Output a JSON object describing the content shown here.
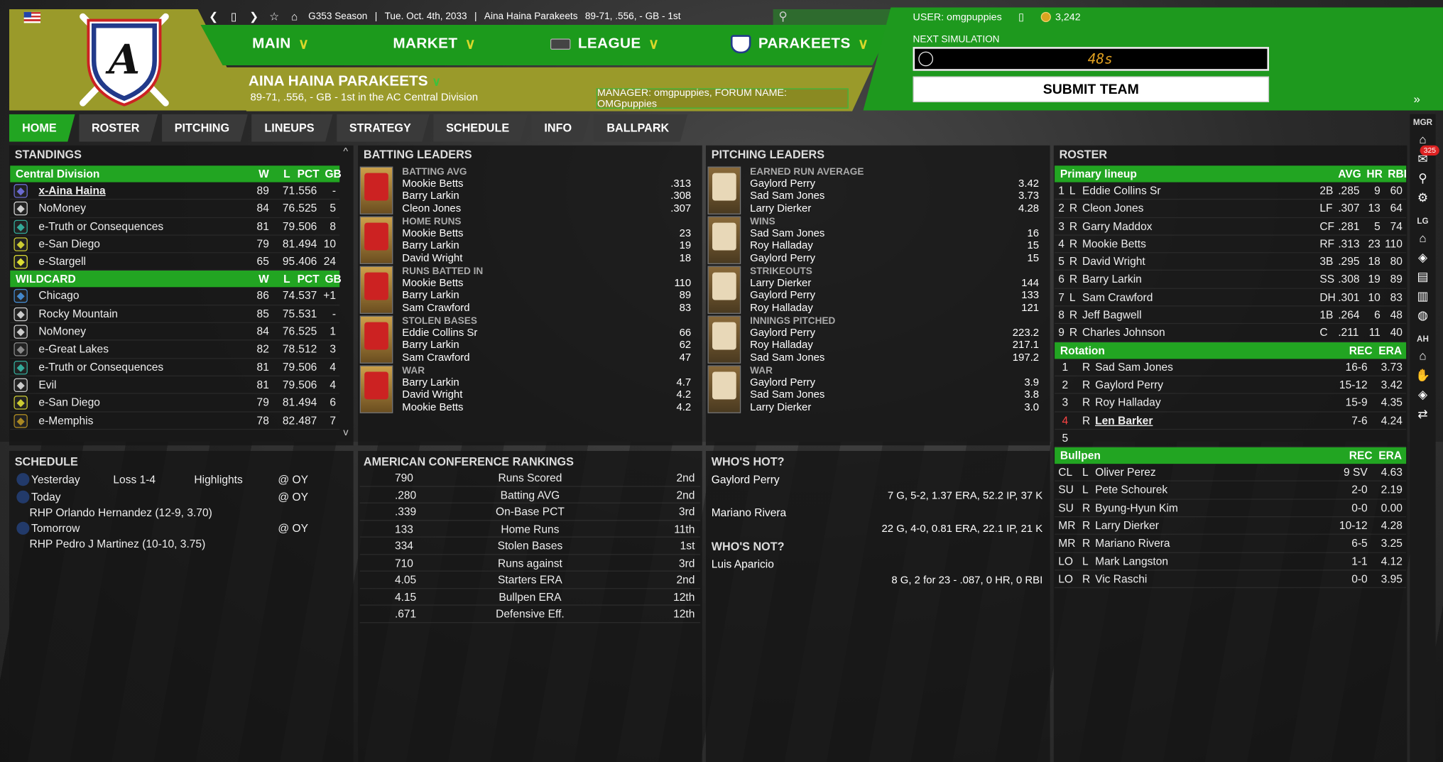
{
  "header": {
    "season": "G353 Season",
    "date": "Tue. Oct. 4th, 2033",
    "team_line": "Aina Haina Parakeets",
    "team_record_short": "89-71, .556, - GB - 1st",
    "nav": [
      {
        "label": "MAIN"
      },
      {
        "label": "MARKET"
      },
      {
        "label": "LEAGUE"
      },
      {
        "label": "PARAKEETS"
      }
    ],
    "team_name": "AINA HAINA PARAKEETS",
    "team_record": "89-71, .556, - GB - 1st in the AC Central Division",
    "manager": "MANAGER:  omgpuppies, FORUM NAME: OMGpuppies",
    "user": "USER: omgpuppies",
    "coins": "3,242",
    "next_sim_label": "NEXT SIMULATION",
    "timer": "48s",
    "submit_label": "SUBMIT TEAM",
    "expand_glyph": "»"
  },
  "tabs": [
    {
      "label": "HOME",
      "active": true
    },
    {
      "label": "ROSTER"
    },
    {
      "label": "PITCHING"
    },
    {
      "label": "LINEUPS"
    },
    {
      "label": "STRATEGY"
    },
    {
      "label": "SCHEDULE"
    },
    {
      "label": "INFO"
    },
    {
      "label": "BALLPARK"
    }
  ],
  "sidebar": {
    "mgr": "MGR",
    "lg": "LG",
    "ah": "AH",
    "badge": "325"
  },
  "standings": {
    "title": "STANDINGS",
    "scroll_up": "^",
    "scroll_down": "v",
    "central_header": {
      "name": "Central Division",
      "w": "W",
      "l": "L",
      "pct": "PCT",
      "gb": "GB"
    },
    "central": [
      {
        "team": "x-Aina Haina",
        "w": "89",
        "l": "71",
        "pct": ".556",
        "gb": "-",
        "icon": "parakeet-logo",
        "color": "#6a6ad0"
      },
      {
        "team": "NoMoney",
        "w": "84",
        "l": "76",
        "pct": ".525",
        "gb": "5",
        "icon": "diamond-logo",
        "color": "#ccc"
      },
      {
        "team": "e-Truth or Consequences",
        "w": "81",
        "l": "79",
        "pct": ".506",
        "gb": "8",
        "icon": "t-logo",
        "color": "#3a9"
      },
      {
        "team": "e-San Diego",
        "w": "79",
        "l": "81",
        "pct": ".494",
        "gb": "10",
        "icon": "m-logo",
        "color": "#cc3"
      },
      {
        "team": "e-Stargell",
        "w": "65",
        "l": "95",
        "pct": ".406",
        "gb": "24",
        "icon": "star-logo",
        "color": "#dd3"
      }
    ],
    "wildcard_header": {
      "name": "WILDCARD",
      "w": "W",
      "l": "L",
      "pct": "PCT",
      "gb": "GB"
    },
    "wildcard": [
      {
        "team": "Chicago",
        "w": "86",
        "l": "74",
        "pct": ".537",
        "gb": "+1",
        "icon": "globe-logo",
        "color": "#48c"
      },
      {
        "team": "Rocky Mountain",
        "w": "85",
        "l": "75",
        "pct": ".531",
        "gb": "-",
        "icon": "diamond-logo",
        "color": "#ccc"
      },
      {
        "team": "NoMoney",
        "w": "84",
        "l": "76",
        "pct": ".525",
        "gb": "1",
        "icon": "diamond-logo",
        "color": "#ccc"
      },
      {
        "team": "e-Great Lakes",
        "w": "82",
        "l": "78",
        "pct": ".512",
        "gb": "3",
        "icon": "script-logo",
        "color": "#888"
      },
      {
        "team": "e-Truth or Consequences",
        "w": "81",
        "l": "79",
        "pct": ".506",
        "gb": "4",
        "icon": "t-logo",
        "color": "#3a9"
      },
      {
        "team": "Evil",
        "w": "81",
        "l": "79",
        "pct": ".506",
        "gb": "4",
        "icon": "ny-logo",
        "color": "#ccc"
      },
      {
        "team": "e-San Diego",
        "w": "79",
        "l": "81",
        "pct": ".494",
        "gb": "6",
        "icon": "m-logo",
        "color": "#cc3"
      },
      {
        "team": "e-Memphis",
        "w": "78",
        "l": "82",
        "pct": ".487",
        "gb": "7",
        "icon": "bear-logo",
        "color": "#a82"
      }
    ]
  },
  "schedule": {
    "title": "SCHEDULE",
    "yesterday": {
      "label": "Yesterday",
      "result": "Loss 1-4",
      "highlights": "Highlights",
      "opp": "@ OY"
    },
    "today": {
      "label": "Today",
      "opp": "@ OY",
      "pitcher": "RHP Orlando Hernandez (12-9, 3.70)"
    },
    "tomorrow": {
      "label": "Tomorrow",
      "opp": "@ OY",
      "pitcher": "RHP Pedro J Martinez (10-10, 3.75)"
    }
  },
  "batting_leaders": {
    "title": "BATTING LEADERS",
    "groups": [
      {
        "stat": "BATTING AVG",
        "rows": [
          [
            "Mookie Betts",
            ".313"
          ],
          [
            "Barry Larkin",
            ".308"
          ],
          [
            "Cleon Jones",
            ".307"
          ]
        ]
      },
      {
        "stat": "HOME RUNS",
        "rows": [
          [
            "Mookie Betts",
            "23"
          ],
          [
            "Barry Larkin",
            "19"
          ],
          [
            "David Wright",
            "18"
          ]
        ]
      },
      {
        "stat": "RUNS BATTED IN",
        "rows": [
          [
            "Mookie Betts",
            "110"
          ],
          [
            "Barry Larkin",
            "89"
          ],
          [
            "Sam Crawford",
            "83"
          ]
        ]
      },
      {
        "stat": "STOLEN BASES",
        "rows": [
          [
            "Eddie Collins Sr",
            "66"
          ],
          [
            "Barry Larkin",
            "62"
          ],
          [
            "Sam Crawford",
            "47"
          ]
        ]
      },
      {
        "stat": "WAR",
        "rows": [
          [
            "Barry Larkin",
            "4.7"
          ],
          [
            "David Wright",
            "4.2"
          ],
          [
            "Mookie Betts",
            "4.2"
          ]
        ]
      }
    ]
  },
  "pitching_leaders": {
    "title": "PITCHING LEADERS",
    "groups": [
      {
        "stat": "EARNED RUN AVERAGE",
        "rows": [
          [
            "Gaylord Perry",
            "3.42"
          ],
          [
            "Sad Sam Jones",
            "3.73"
          ],
          [
            "Larry Dierker",
            "4.28"
          ]
        ]
      },
      {
        "stat": "WINS",
        "rows": [
          [
            "Sad Sam Jones",
            "16"
          ],
          [
            "Roy Halladay",
            "15"
          ],
          [
            "Gaylord Perry",
            "15"
          ]
        ]
      },
      {
        "stat": "STRIKEOUTS",
        "rows": [
          [
            "Larry Dierker",
            "144"
          ],
          [
            "Gaylord Perry",
            "133"
          ],
          [
            "Roy Halladay",
            "121"
          ]
        ]
      },
      {
        "stat": "INNINGS PITCHED",
        "rows": [
          [
            "Gaylord Perry",
            "223.2"
          ],
          [
            "Roy Halladay",
            "217.1"
          ],
          [
            "Sad Sam Jones",
            "197.2"
          ]
        ]
      },
      {
        "stat": "WAR",
        "rows": [
          [
            "Gaylord Perry",
            "3.9"
          ],
          [
            "Sad Sam Jones",
            "3.8"
          ],
          [
            "Larry Dierker",
            "3.0"
          ]
        ]
      }
    ]
  },
  "rankings": {
    "title": "AMERICAN CONFERENCE RANKINGS",
    "rows": [
      {
        "value": "790",
        "label": "Runs Scored",
        "rank": "2nd"
      },
      {
        "value": ".280",
        "label": "Batting AVG",
        "rank": "2nd"
      },
      {
        "value": ".339",
        "label": "On-Base PCT",
        "rank": "3rd"
      },
      {
        "value": "133",
        "label": "Home Runs",
        "rank": "11th"
      },
      {
        "value": "334",
        "label": "Stolen Bases",
        "rank": "1st"
      },
      {
        "value": "710",
        "label": "Runs against",
        "rank": "3rd"
      },
      {
        "value": "4.05",
        "label": "Starters ERA",
        "rank": "2nd"
      },
      {
        "value": "4.15",
        "label": "Bullpen ERA",
        "rank": "12th"
      },
      {
        "value": ".671",
        "label": "Defensive Eff.",
        "rank": "12th"
      }
    ]
  },
  "hot": {
    "title": "WHO'S HOT?",
    "players": [
      {
        "name": "Gaylord Perry",
        "line": "7 G, 5-2, 1.37 ERA, 52.2 IP, 37 K"
      },
      {
        "name": "Mariano Rivera",
        "line": "22 G, 4-0, 0.81 ERA, 22.1 IP, 21 K"
      }
    ],
    "not_title": "WHO'S NOT?",
    "not_players": [
      {
        "name": "Luis Aparicio",
        "line": "8 G, 2 for 23 - .087, 0 HR, 0 RBI"
      }
    ]
  },
  "roster": {
    "title": "ROSTER",
    "lineup_header": {
      "name": "Primary lineup",
      "avg": "AVG",
      "hr": "HR",
      "rbi": "RBI"
    },
    "lineup": [
      {
        "n": "1",
        "hand": "L",
        "name": "Eddie Collins Sr",
        "pos": "2B",
        "avg": ".285",
        "hr": "9",
        "rbi": "60"
      },
      {
        "n": "2",
        "hand": "R",
        "name": "Cleon Jones",
        "pos": "LF",
        "avg": ".307",
        "hr": "13",
        "rbi": "64"
      },
      {
        "n": "3",
        "hand": "R",
        "name": "Garry Maddox",
        "pos": "CF",
        "avg": ".281",
        "hr": "5",
        "rbi": "74"
      },
      {
        "n": "4",
        "hand": "R",
        "name": "Mookie Betts",
        "pos": "RF",
        "avg": ".313",
        "hr": "23",
        "rbi": "110"
      },
      {
        "n": "5",
        "hand": "R",
        "name": "David Wright",
        "pos": "3B",
        "avg": ".295",
        "hr": "18",
        "rbi": "80"
      },
      {
        "n": "6",
        "hand": "R",
        "name": "Barry Larkin",
        "pos": "SS",
        "avg": ".308",
        "hr": "19",
        "rbi": "89"
      },
      {
        "n": "7",
        "hand": "L",
        "name": "Sam Crawford",
        "pos": "DH",
        "avg": ".301",
        "hr": "10",
        "rbi": "83"
      },
      {
        "n": "8",
        "hand": "R",
        "name": "Jeff Bagwell",
        "pos": "1B",
        "avg": ".264",
        "hr": "6",
        "rbi": "48"
      },
      {
        "n": "9",
        "hand": "R",
        "name": "Charles Johnson",
        "pos": "C",
        "avg": ".211",
        "hr": "11",
        "rbi": "40"
      }
    ],
    "rotation_header": {
      "name": "Rotation",
      "rec": "REC",
      "era": "ERA"
    },
    "rotation": [
      {
        "n": "1",
        "hand": "R",
        "name": "Sad Sam Jones",
        "rec": "16-6",
        "era": "3.73"
      },
      {
        "n": "2",
        "hand": "R",
        "name": "Gaylord Perry",
        "rec": "15-12",
        "era": "3.42"
      },
      {
        "n": "3",
        "hand": "R",
        "name": "Roy Halladay",
        "rec": "15-9",
        "era": "4.35"
      },
      {
        "n": "4",
        "hand": "R",
        "name": "Len Barker",
        "rec": "7-6",
        "era": "4.24"
      },
      {
        "n": "5",
        "hand": "",
        "name": "",
        "rec": "",
        "era": ""
      }
    ],
    "bullpen_header": {
      "name": "Bullpen",
      "rec": "REC",
      "era": "ERA"
    },
    "bullpen": [
      {
        "role": "CL",
        "hand": "L",
        "name": "Oliver Perez",
        "rec": "9 SV",
        "era": "4.63"
      },
      {
        "role": "SU",
        "hand": "L",
        "name": "Pete Schourek",
        "rec": "2-0",
        "era": "2.19"
      },
      {
        "role": "SU",
        "hand": "R",
        "name": "Byung-Hyun Kim",
        "rec": "0-0",
        "era": "0.00"
      },
      {
        "role": "MR",
        "hand": "R",
        "name": "Larry Dierker",
        "rec": "10-12",
        "era": "4.28"
      },
      {
        "role": "MR",
        "hand": "R",
        "name": "Mariano Rivera",
        "rec": "6-5",
        "era": "3.25"
      },
      {
        "role": "LO",
        "hand": "L",
        "name": "Mark Langston",
        "rec": "1-1",
        "era": "4.12"
      },
      {
        "role": "LO",
        "hand": "R",
        "name": "Vic Raschi",
        "rec": "0-0",
        "era": "3.95"
      }
    ]
  },
  "colors": {
    "accent_green": "#22a522",
    "olive": "#9a9a2a",
    "timer": "#e0a020",
    "red_num": "#ff4444"
  }
}
